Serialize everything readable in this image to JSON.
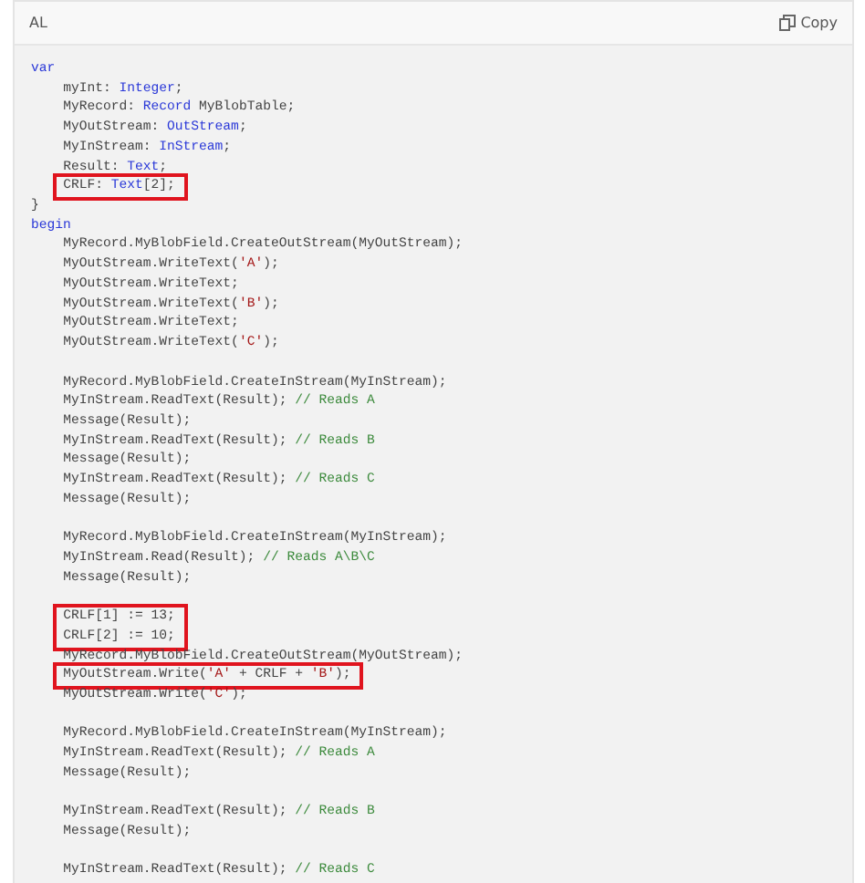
{
  "header": {
    "language": "AL",
    "copy_label": "Copy"
  },
  "code": [
    {
      "kind": "code",
      "tokens": [
        {
          "kind": "keyword",
          "text": "var"
        }
      ],
      "children": [
        {
          "kind": "code",
          "tokens": [
            {
              "kind": "plain",
              "text": "myInt: "
            },
            {
              "kind": "type",
              "text": "Integer"
            },
            {
              "kind": "plain",
              "text": ";"
            }
          ]
        },
        {
          "kind": "code",
          "tokens": [
            {
              "kind": "plain",
              "text": "MyRecord: "
            },
            {
              "kind": "type",
              "text": "Record"
            },
            {
              "kind": "plain",
              "text": " MyBlobTable;"
            }
          ]
        },
        {
          "kind": "code",
          "tokens": [
            {
              "kind": "plain",
              "text": "MyOutStream: "
            },
            {
              "kind": "type",
              "text": "OutStream"
            },
            {
              "kind": "plain",
              "text": ";"
            }
          ]
        },
        {
          "kind": "code",
          "tokens": [
            {
              "kind": "plain",
              "text": "MyInStream: "
            },
            {
              "kind": "type",
              "text": "InStream"
            },
            {
              "kind": "plain",
              "text": ";"
            }
          ]
        },
        {
          "kind": "code",
          "tokens": [
            {
              "kind": "plain",
              "text": "Result: "
            },
            {
              "kind": "type",
              "text": "Text"
            },
            {
              "kind": "plain",
              "text": ";"
            }
          ]
        },
        {
          "kind": "code",
          "highlighted": true,
          "tokens": [
            {
              "kind": "plain",
              "text": "CRLF: "
            },
            {
              "kind": "type",
              "text": "Text"
            },
            {
              "kind": "plain",
              "text": "[2];"
            }
          ]
        }
      ]
    },
    {
      "kind": "code",
      "tokens": [
        {
          "kind": "plain",
          "text": "}"
        }
      ]
    },
    {
      "kind": "code",
      "tokens": [
        {
          "kind": "keyword",
          "text": "begin"
        }
      ],
      "children": [
        {
          "kind": "code",
          "tokens": [
            {
              "kind": "plain",
              "text": "MyRecord.MyBlobField.CreateOutStream(MyOutStream);"
            }
          ]
        },
        {
          "kind": "code",
          "tokens": [
            {
              "kind": "plain",
              "text": "MyOutStream.WriteText("
            },
            {
              "kind": "string",
              "text": "'A'"
            },
            {
              "kind": "plain",
              "text": ");"
            }
          ]
        },
        {
          "kind": "code",
          "tokens": [
            {
              "kind": "plain",
              "text": "MyOutStream.WriteText;"
            }
          ]
        },
        {
          "kind": "code",
          "tokens": [
            {
              "kind": "plain",
              "text": "MyOutStream.WriteText("
            },
            {
              "kind": "string",
              "text": "'B'"
            },
            {
              "kind": "plain",
              "text": ");"
            }
          ]
        },
        {
          "kind": "code",
          "tokens": [
            {
              "kind": "plain",
              "text": "MyOutStream.WriteText;"
            }
          ]
        },
        {
          "kind": "code",
          "tokens": [
            {
              "kind": "plain",
              "text": "MyOutStream.WriteText("
            },
            {
              "kind": "string",
              "text": "'C'"
            },
            {
              "kind": "plain",
              "text": ");"
            }
          ]
        },
        {
          "kind": "blank"
        },
        {
          "kind": "code",
          "tokens": [
            {
              "kind": "plain",
              "text": "MyRecord.MyBlobField.CreateInStream(MyInStream);"
            }
          ]
        },
        {
          "kind": "code",
          "tokens": [
            {
              "kind": "plain",
              "text": "MyInStream.ReadText(Result); "
            },
            {
              "kind": "comment",
              "text": "// Reads A"
            }
          ]
        },
        {
          "kind": "code",
          "tokens": [
            {
              "kind": "plain",
              "text": "Message(Result);"
            }
          ]
        },
        {
          "kind": "code",
          "tokens": [
            {
              "kind": "plain",
              "text": "MyInStream.ReadText(Result); "
            },
            {
              "kind": "comment",
              "text": "// Reads B"
            }
          ]
        },
        {
          "kind": "code",
          "tokens": [
            {
              "kind": "plain",
              "text": "Message(Result);"
            }
          ]
        },
        {
          "kind": "code",
          "tokens": [
            {
              "kind": "plain",
              "text": "MyInStream.ReadText(Result); "
            },
            {
              "kind": "comment",
              "text": "// Reads C"
            }
          ]
        },
        {
          "kind": "code",
          "tokens": [
            {
              "kind": "plain",
              "text": "Message(Result);"
            }
          ]
        },
        {
          "kind": "blank"
        },
        {
          "kind": "code",
          "tokens": [
            {
              "kind": "plain",
              "text": "MyRecord.MyBlobField.CreateInStream(MyInStream);"
            }
          ]
        },
        {
          "kind": "code",
          "tokens": [
            {
              "kind": "plain",
              "text": "MyInStream.Read(Result); "
            },
            {
              "kind": "comment",
              "text": "// Reads A\\B\\C"
            }
          ]
        },
        {
          "kind": "code",
          "tokens": [
            {
              "kind": "plain",
              "text": "Message(Result);"
            }
          ]
        },
        {
          "kind": "blank"
        },
        {
          "kind": "code",
          "highlighted": true,
          "tokens": [
            {
              "kind": "plain",
              "text": "CRLF[1] := 13;"
            }
          ]
        },
        {
          "kind": "code",
          "highlighted": true,
          "tokens": [
            {
              "kind": "plain",
              "text": "CRLF[2] := 10;"
            }
          ]
        },
        {
          "kind": "code",
          "tokens": [
            {
              "kind": "plain",
              "text": "MyRecord.MyBlobField.CreateOutStream(MyOutStream);"
            }
          ]
        },
        {
          "kind": "code",
          "highlighted": true,
          "tokens": [
            {
              "kind": "plain",
              "text": "MyOutStream.Write("
            },
            {
              "kind": "string",
              "text": "'A'"
            },
            {
              "kind": "plain",
              "text": " + CRLF + "
            },
            {
              "kind": "string",
              "text": "'B'"
            },
            {
              "kind": "plain",
              "text": ");"
            }
          ]
        },
        {
          "kind": "code",
          "tokens": [
            {
              "kind": "plain",
              "text": "MyOutStream.Write("
            },
            {
              "kind": "string",
              "text": "'C'"
            },
            {
              "kind": "plain",
              "text": ");"
            }
          ]
        },
        {
          "kind": "blank"
        },
        {
          "kind": "code",
          "tokens": [
            {
              "kind": "plain",
              "text": "MyRecord.MyBlobField.CreateInStream(MyInStream);"
            }
          ]
        },
        {
          "kind": "code",
          "tokens": [
            {
              "kind": "plain",
              "text": "MyInStream.ReadText(Result); "
            },
            {
              "kind": "comment",
              "text": "// Reads A"
            }
          ]
        },
        {
          "kind": "code",
          "tokens": [
            {
              "kind": "plain",
              "text": "Message(Result);"
            }
          ]
        },
        {
          "kind": "blank"
        },
        {
          "kind": "code",
          "tokens": [
            {
              "kind": "plain",
              "text": "MyInStream.ReadText(Result); "
            },
            {
              "kind": "comment",
              "text": "// Reads B"
            }
          ]
        },
        {
          "kind": "code",
          "tokens": [
            {
              "kind": "plain",
              "text": "Message(Result);"
            }
          ]
        },
        {
          "kind": "blank"
        },
        {
          "kind": "code",
          "tokens": [
            {
              "kind": "plain",
              "text": "MyInStream.ReadText(Result); "
            },
            {
              "kind": "comment",
              "text": "// Reads C"
            }
          ]
        }
      ]
    }
  ]
}
